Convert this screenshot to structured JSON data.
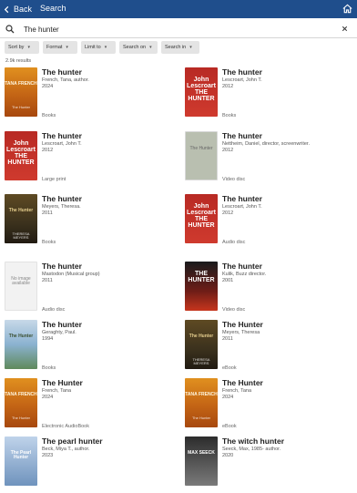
{
  "header": {
    "back_label": "Back",
    "title": "Search"
  },
  "search": {
    "value": "The hunter",
    "placeholder": ""
  },
  "filters": [
    {
      "label": "Sort by"
    },
    {
      "label": "Format"
    },
    {
      "label": "Limit to"
    },
    {
      "label": "Search on"
    },
    {
      "label": "Search in"
    }
  ],
  "results_count": "2.9k results",
  "results": [
    {
      "title": "The hunter",
      "author": "French, Tana, author.",
      "year": "2024",
      "format": "Books",
      "cover": "c-french",
      "cover_title": "TANA FRENCH",
      "cover_sub": "The Hunter"
    },
    {
      "title": "The hunter",
      "author": "Lescroart, John T.",
      "year": "2012",
      "format": "Books",
      "cover": "c-lesc",
      "cover_title": "John Lescroart THE HUNTER",
      "cover_sub": ""
    },
    {
      "title": "The hunter",
      "author": "Lescroart, John T.",
      "year": "2012",
      "format": "Large print",
      "cover": "c-lesc",
      "cover_title": "John Lescroart THE HUNTER",
      "cover_sub": ""
    },
    {
      "title": "The hunter",
      "author": "Nettheim, Daniel, director, screenwriter.",
      "year": "2012",
      "format": "Video disc",
      "cover": "c-nett",
      "cover_title": "The Hunter",
      "cover_sub": ""
    },
    {
      "title": "The hunter",
      "author": "Meyers, Theresa.",
      "year": "2011",
      "format": "Books",
      "cover": "c-meyers",
      "cover_title": "The Hunter",
      "cover_sub": "THERESA MEYERS"
    },
    {
      "title": "The hunter",
      "author": "Lescroart, John T.",
      "year": "2012",
      "format": "Audio disc",
      "cover": "c-lesc",
      "cover_title": "John Lescroart THE HUNTER",
      "cover_sub": ""
    },
    {
      "title": "The hunter",
      "author": "Mastodon (Musical group)",
      "year": "2011",
      "format": "Audio disc",
      "cover": "c-noimg",
      "cover_title": "No image available",
      "cover_sub": ""
    },
    {
      "title": "The hunter",
      "author": "Kulik, Buzz director.",
      "year": "2001",
      "format": "Video disc",
      "cover": "c-kulik",
      "cover_title": "THE HUNTER",
      "cover_sub": ""
    },
    {
      "title": "The hunter",
      "author": "Geraghty, Paul.",
      "year": "1994",
      "format": "Books",
      "cover": "c-gera",
      "cover_title": "The Hunter",
      "cover_sub": ""
    },
    {
      "title": "The Hunter",
      "author": "Meyers, Theresa",
      "year": "2011",
      "format": "eBook",
      "cover": "c-meyers",
      "cover_title": "The Hunter",
      "cover_sub": "THERESA MEYERS"
    },
    {
      "title": "The Hunter",
      "author": "French, Tana",
      "year": "2024",
      "format": "Electronic AudioBook",
      "cover": "c-french",
      "cover_title": "TANA FRENCH",
      "cover_sub": "The Hunter"
    },
    {
      "title": "The Hunter",
      "author": "French, Tana",
      "year": "2024",
      "format": "eBook",
      "cover": "c-french",
      "cover_title": "TANA FRENCH",
      "cover_sub": "The Hunter"
    },
    {
      "title": "The pearl hunter",
      "author": "Beck, Miya T., author.",
      "year": "2023",
      "format": "",
      "cover": "c-pearl",
      "cover_title": "The Pearl Hunter",
      "cover_sub": ""
    },
    {
      "title": "The witch hunter",
      "author": "Seeck, Max, 1985- author.",
      "year": "2020",
      "format": "",
      "cover": "c-witch",
      "cover_title": "MAX SEECK",
      "cover_sub": ""
    }
  ],
  "colors": {
    "header_bg": "#1f4e8c",
    "chip_bg": "#e4e4e4"
  },
  "icons": [
    "back-arrow-icon",
    "home-icon",
    "search-icon",
    "clear-icon",
    "chevron-down-icon"
  ]
}
